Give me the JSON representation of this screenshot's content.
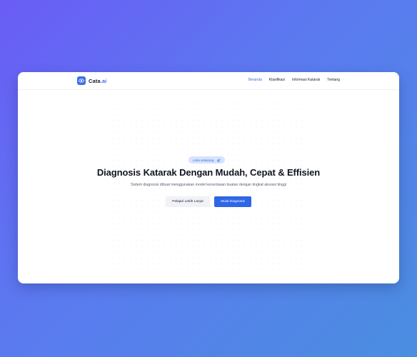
{
  "brand": {
    "name_main": "Cata",
    "name_accent": ".ai",
    "logo_icon": "eye-icon"
  },
  "nav": {
    "items": [
      {
        "label": "Beranda",
        "active": true
      },
      {
        "label": "Klasifikasi",
        "active": false
      },
      {
        "label": "Informasi Katarak",
        "active": false
      },
      {
        "label": "Tentang",
        "active": false
      }
    ]
  },
  "hero": {
    "badge_label": "coba sekarang",
    "badge_icon": "rocket-icon",
    "title": "Diagnosis Katarak Dengan Mudah, Cepat & Effisien",
    "subtitle": "Sistem diagnosis dibuat menggunakan model kecerdasan buatan dengan tingkat akurasi tinggi",
    "secondary_button": "Pelajari Lebih Lanjut",
    "primary_button": "Mulai Diagnosis"
  },
  "colors": {
    "accent": "#3d6ee8",
    "primary_button": "#2e66e6",
    "badge_bg": "#d6e4fd",
    "background_start": "#6a5cf5",
    "background_end": "#4a8ee0"
  }
}
